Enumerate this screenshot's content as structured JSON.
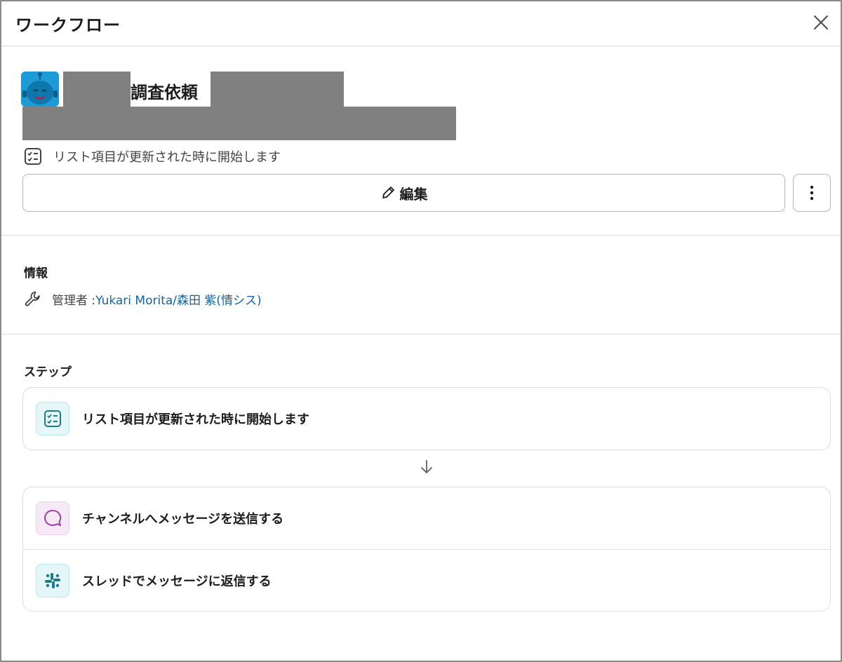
{
  "header": {
    "title": "ワークフロー"
  },
  "workflow": {
    "name": "調査依頼",
    "trigger_text": "リスト項目が更新された時に開始します",
    "edit_label": "編集"
  },
  "info": {
    "heading": "情報",
    "admin_label": "管理者 : ",
    "admin_name": "Yukari Morita/森田 紫(情シス)"
  },
  "steps": {
    "heading": "ステップ",
    "items": [
      {
        "label": "リスト項目が更新された時に開始します",
        "icon": "list-checklist-icon"
      },
      {
        "label": "チャンネルへメッセージを送信する",
        "icon": "message-bubble-icon"
      },
      {
        "label": "スレッドでメッセージに返信する",
        "icon": "slack-logo-icon"
      }
    ]
  },
  "colors": {
    "link": "#1264a3",
    "bot_icon_bg": "#1e9bd7",
    "teal_icon": "#1d7c8c",
    "purple_icon": "#9e3faa"
  }
}
